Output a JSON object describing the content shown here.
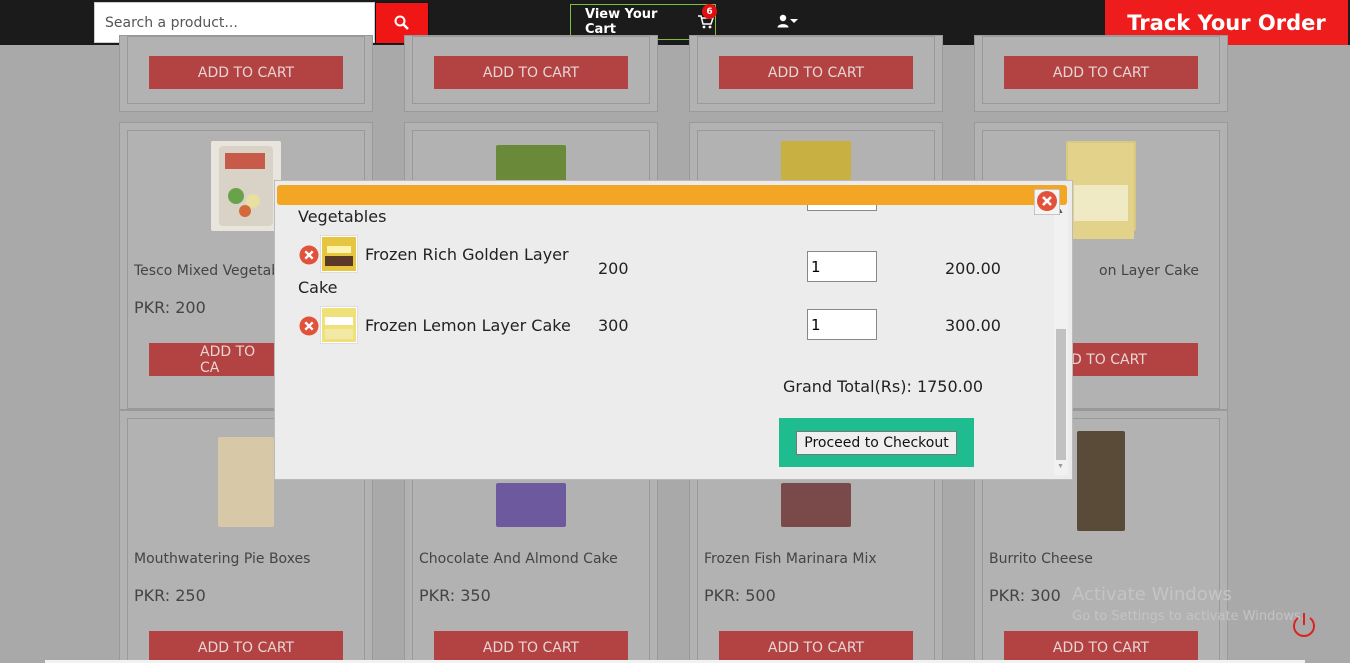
{
  "header": {
    "search_placeholder": "Search a product...",
    "cart_label": "View Your Cart",
    "cart_count": "6",
    "track_label": "Track Your Order"
  },
  "products": [
    {
      "name": "",
      "price": "",
      "button": "ADD TO CART"
    },
    {
      "name": "",
      "price": "",
      "button": "ADD TO CART"
    },
    {
      "name": "",
      "price": "",
      "button": "ADD TO CART"
    },
    {
      "name": "",
      "price": "",
      "button": "ADD TO CART"
    },
    {
      "name": "Tesco Mixed Vegetab",
      "price": "PKR: 200",
      "button": "ADD TO CA"
    },
    {
      "name": "",
      "price": "",
      "button": ""
    },
    {
      "name": "",
      "price": "",
      "button": ""
    },
    {
      "name": "on Layer Cake",
      "price": "",
      "button": "D TO CART"
    },
    {
      "name": "Mouthwatering Pie Boxes",
      "price": "PKR: 250",
      "button": "ADD TO CART"
    },
    {
      "name": "Chocolate And Almond Cake",
      "price": "PKR: 350",
      "button": "ADD TO CART"
    },
    {
      "name": "Frozen Fish Marinara Mix",
      "price": "PKR: 500",
      "button": "ADD TO CART"
    },
    {
      "name": "Burrito Cheese",
      "price": "PKR: 300",
      "button": "ADD TO CART"
    }
  ],
  "cart_modal": {
    "rows": [
      {
        "name_line1": "",
        "name_line2": "Vegetables",
        "price": "",
        "qty": "",
        "total": ""
      },
      {
        "name_line1": "Frozen Rich Golden Layer",
        "name_line2": "Cake",
        "price": "200",
        "qty": "1",
        "total": "200.00"
      },
      {
        "name_line1": "Frozen Lemon Layer Cake",
        "name_line2": "",
        "price": "300",
        "qty": "1",
        "total": "300.00"
      }
    ],
    "grand_total": "Grand Total(Rs): 1750.00",
    "checkout_label": "Proceed to Checkout"
  },
  "watermark": {
    "title": "Activate Windows",
    "subtitle": "Go to Settings to activate Windows."
  },
  "colors": {
    "topbar": "#1b1b1b",
    "accent_red": "#ee1c1c",
    "modal_bar": "#f2a623",
    "checkout_green": "#1ebc8f"
  }
}
